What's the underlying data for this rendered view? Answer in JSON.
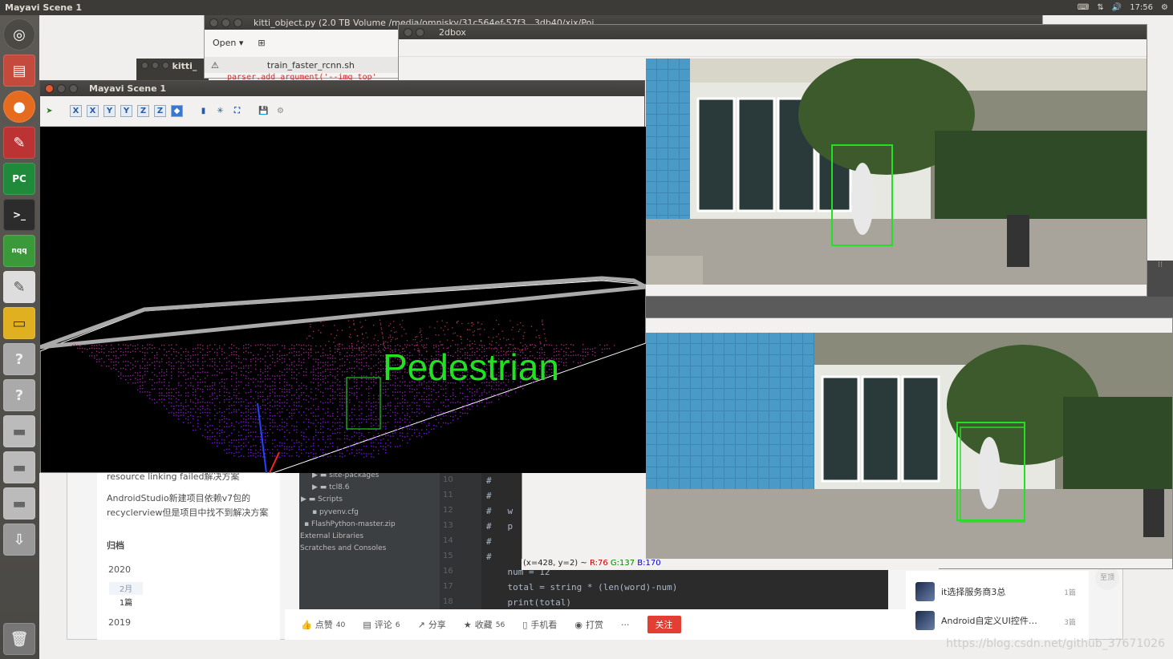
{
  "top_panel": {
    "title": "Mayavi Scene 1",
    "time": "17:56"
  },
  "launcher": {
    "items": [
      "dash",
      "files",
      "firefox",
      "settings",
      "pycharm",
      "terminal",
      "app",
      "text-editor",
      "screenshot",
      "unknown",
      "unknown",
      "drive",
      "drive",
      "drive",
      "usb",
      "trash"
    ]
  },
  "gedit_window": {
    "title": "kitti_object.py (2.0 TB Volume /media/omnisky/31c564ef-57f3...3db40/xix/Poi...",
    "open_label": "Open",
    "tab_label": "train_faster_rcnn.sh",
    "code_snippet": "parser.add_argument('--img_top'"
  },
  "kitti_window": {
    "title": "kitti_"
  },
  "dbox_window": {
    "title": "2dbox"
  },
  "mayavi_window": {
    "title": "Mayavi Scene 1",
    "label": "Pedestrian"
  },
  "image_window": {
    "status_prefix": "(x=428, y=2) ~ ",
    "r": "R:76",
    "g": "G:137",
    "b": "B:170"
  },
  "blog": {
    "link1": "resource linking failed解决方案",
    "link2a": "AndroidStudio新建项目依赖v7包的",
    "link2b": "recyclerview但是项目中找不到解决方案",
    "archive_heading": "归档",
    "year1": "2020",
    "month1": "2月",
    "count1": "1篇",
    "year2": "2019"
  },
  "ide": {
    "tree": [
      "site-packages",
      "tcl8.6",
      "Scripts",
      "pyvenv.cfg",
      "FlashPython-master.zip",
      "External Libraries",
      "Scratches and Consoles"
    ],
    "line_numbers": [
      "10",
      "11",
      "12",
      "13",
      "14",
      "15",
      "16",
      "17",
      "18"
    ],
    "code": [
      "#",
      "#",
      "#   w",
      "#   p",
      "#",
      "#",
      "    num = 12",
      "    total = string * (len(word)-num)",
      "    print(total)"
    ]
  },
  "actions": {
    "like": "点赞",
    "like_count": "40",
    "comment": "评论",
    "comment_count": "6",
    "share": "分享",
    "favorite": "收藏",
    "favorite_count": "56",
    "mobile": "手机看",
    "reward": "打赏",
    "more": "···",
    "follow": "关注"
  },
  "side_list": {
    "item1": "it选择服务商3总",
    "item1_count": "1篇",
    "item2": "Android自定义UI控件…",
    "item2_count": "3篇",
    "scroll_label": "至顶"
  },
  "watermark": "https://blog.csdn.net/github_37671026"
}
